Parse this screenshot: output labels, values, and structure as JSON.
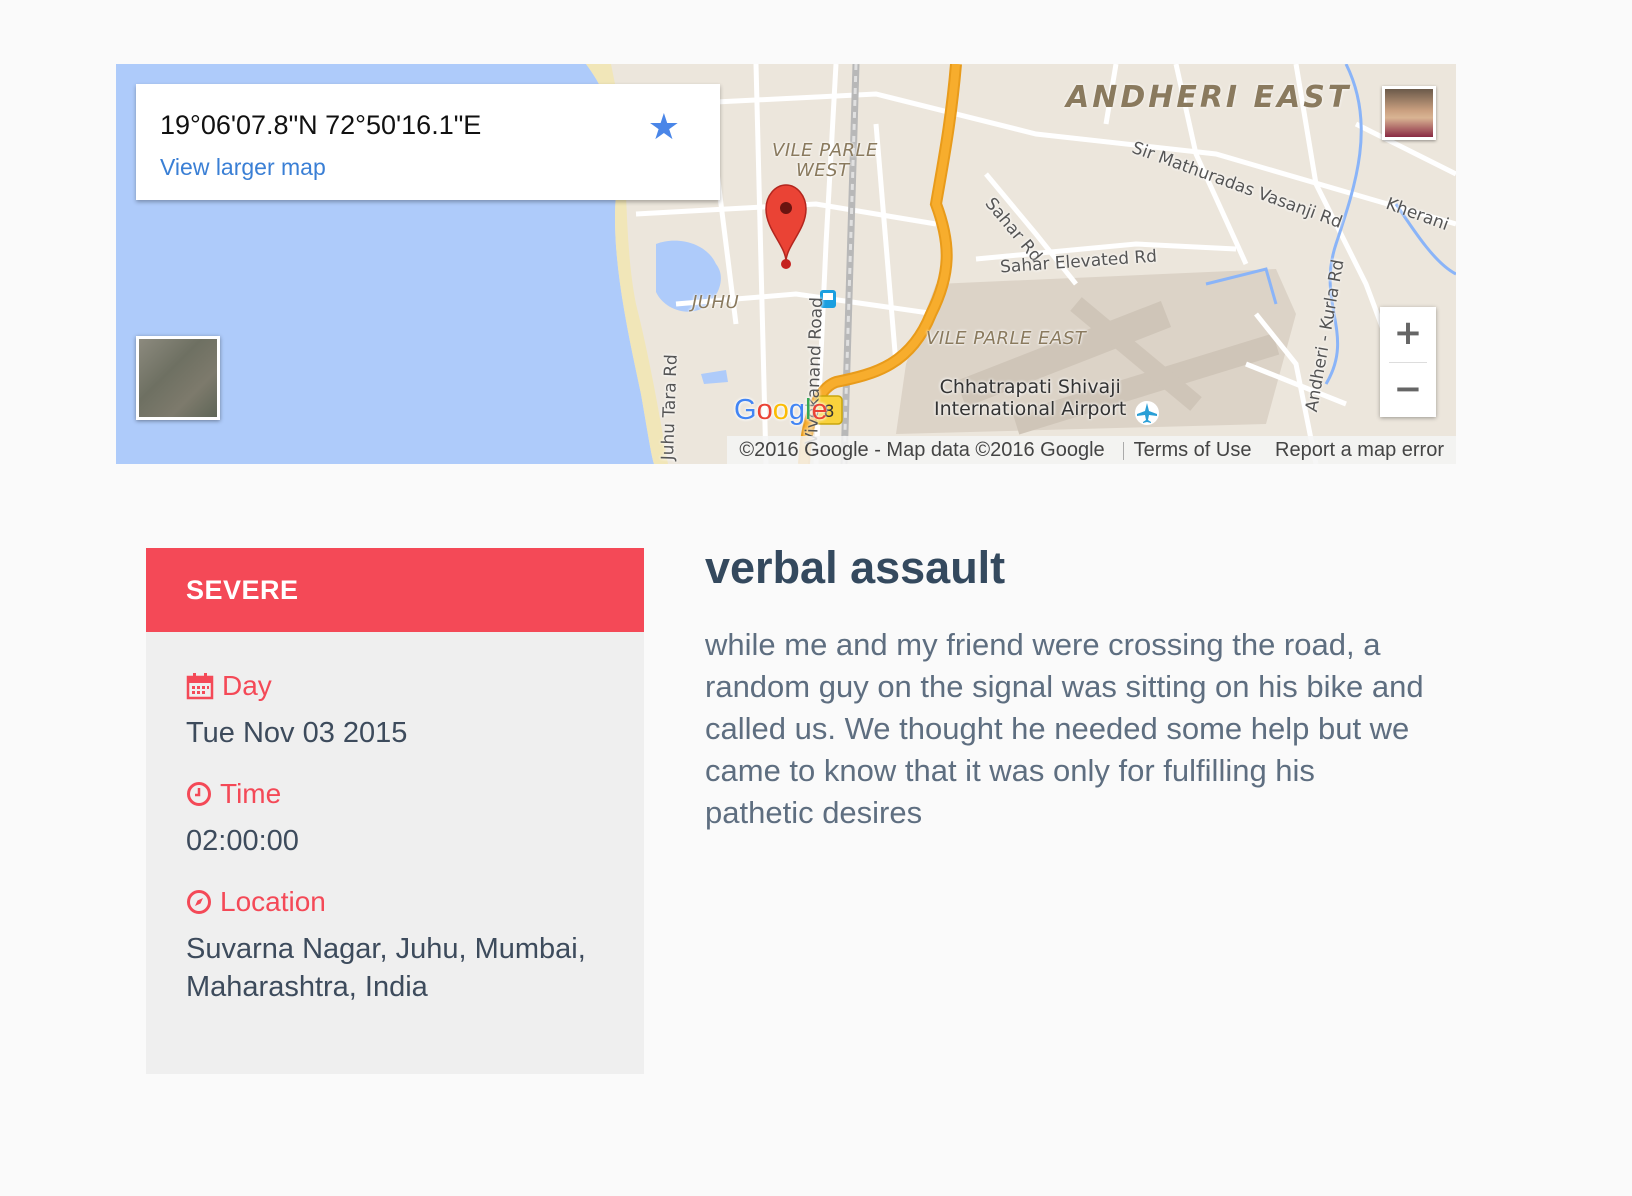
{
  "map": {
    "coordinates": "19°06'07.8\"N 72°50'16.1\"E",
    "view_larger_label": "View larger map",
    "labels": {
      "andheri_east": "ANDHERI EAST",
      "vile_parle_west_1": "VILE PARLE",
      "vile_parle_west_2": "WEST",
      "juhu": "JUHU",
      "vile_parle_east": "VILE PARLE EAST",
      "sahar_rd": "Sahar Rd",
      "sahar_elevated_rd": "Sahar Elevated Rd",
      "sir_mathuradas": "Sir Mathuradas Vasanji Rd",
      "kherani": "Kherani",
      "andheri_kurla": "Andheri - Kurla Rd",
      "juhu_tara": "Juhu Tara Rd",
      "vivekanand": "Vivekanand Road",
      "airport_1": "Chhatrapati Shivaji",
      "airport_2": "International Airport",
      "route_badge": "8"
    },
    "attribution": "©2016 Google - Map data ©2016 Google",
    "terms_label": "Terms of Use",
    "report_label": "Report a map error",
    "zoom_in": "+",
    "zoom_out": "−",
    "google_logo": "Google",
    "colors": {
      "water": "#aecbfa",
      "land": "#ece6dc",
      "highway": "#f5a623",
      "marker": "#ea4335"
    }
  },
  "incident": {
    "severity": "SEVERE",
    "day_label": "Day",
    "day_value": "Tue Nov 03 2015",
    "time_label": "Time",
    "time_value": "02:00:00",
    "location_label": "Location",
    "location_value": "Suvarna Nagar, Juhu, Mumbai, Maharashtra, India",
    "title": "verbal assault",
    "description": "while me and my friend were crossing the road, a random guy on the signal was sitting on his bike and called us. We thought he needed some help but we came to know that it was only for fulfilling his pathetic desires",
    "accent_color": "#f44957"
  },
  "icons": {
    "star": "star-icon",
    "calendar": "calendar-icon",
    "clock": "clock-icon",
    "compass": "compass-icon",
    "pin": "map-pin-icon",
    "airport": "airport-icon",
    "bus": "bus-stop-icon"
  }
}
